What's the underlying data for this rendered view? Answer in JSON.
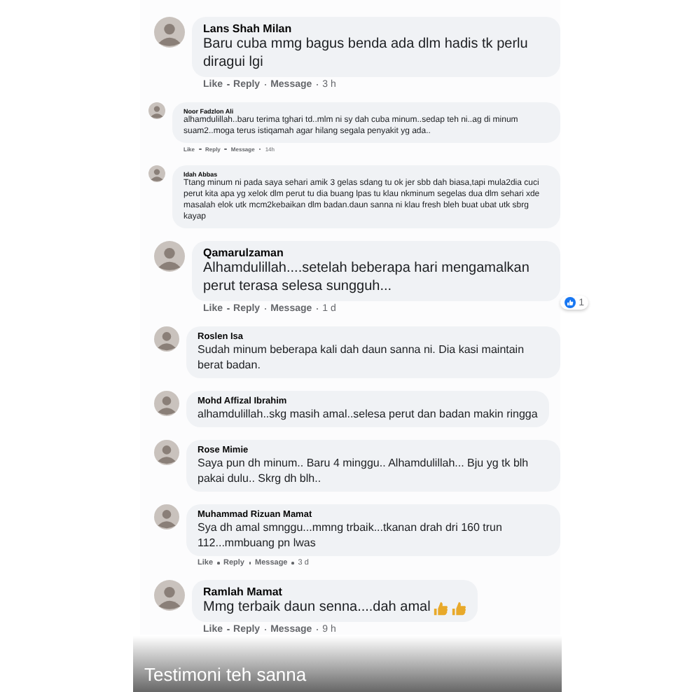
{
  "comments": [
    {
      "kind": "large",
      "name": "Lans Shah Milan",
      "text": "Baru cuba mmg bagus benda ada dlm hadis tk perlu diragui lgi",
      "actions": [
        "Like",
        "Reply",
        "Message",
        "3 h"
      ]
    },
    {
      "kind": "small",
      "name": "Noor Fadzlon Ali",
      "text": "alhamdulillah..baru terima tghari td..mlm ni sy dah cuba minum..sedap teh ni..ag di minum suam2..moga terus istiqamah agar hilang segala penyakit yg ada..",
      "actions": [
        "Like",
        "Reply",
        "Message",
        "14h"
      ]
    },
    {
      "kind": "small",
      "name": "Idah Abbas",
      "text": "Ttang minum ni pada saya sehari amik 3 gelas sdang tu ok jer sbb dah biasa,tapi mula2dia cuci perut kita apa yg xelok dlm perut tu dia buang lpas tu klau nkminum segelas dua dlm sehari xde masalah elok utk mcm2kebaikan dlm badan.daun sanna ni klau fresh bleh buat ubat utk sbrg kayap"
    },
    {
      "kind": "large",
      "name": "Qamarulzaman",
      "text": "Alhamdulillah....setelah beberapa hari mengamalkan perut terasa selesa sungguh...",
      "actions": [
        "Like",
        "Reply",
        "Message",
        "1 d"
      ],
      "likes": "1"
    },
    {
      "kind": "medium",
      "name": "Roslen Isa",
      "text": "Sudah minum beberapa kali dah daun sanna ni. Dia kasi maintain berat badan."
    },
    {
      "kind": "medium",
      "name": "Mohd Affizal Ibrahim",
      "text": "alhamdulillah..skg masih amal..selesa perut dan badan makin ringga"
    },
    {
      "kind": "medium",
      "name": "Rose Mimie",
      "text": "Saya pun dh minum.. Baru 4 minggu.. Alhamdulillah... Bju yg tk blh pakai dulu.. Skrg dh blh.."
    },
    {
      "kind": "medium",
      "name": "Muhammad Rizuan Mamat",
      "text": "Sya dh amal smnggu...mmng trbaik...tkanan drah dri 160 trun 112...mmbuang pn lwas",
      "actions": [
        "Like",
        "Reply",
        "Message",
        "3 d"
      ]
    },
    {
      "kind": "large",
      "name": "Ramlah Mamat",
      "text": "Mmg terbaik daun senna....dah amal",
      "emojis": [
        {
          "kind": "thumbs-up"
        },
        {
          "kind": "thumbs-up"
        }
      ],
      "actions": [
        "Like",
        "Reply",
        "Message",
        "9 h"
      ]
    }
  ],
  "caption": "Testimoni teh sanna"
}
